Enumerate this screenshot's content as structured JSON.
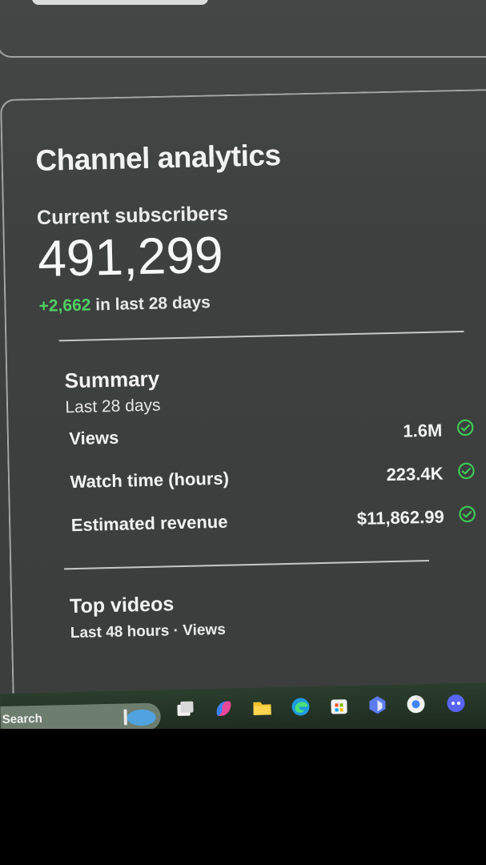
{
  "header": {
    "title": "Channel analytics"
  },
  "subscribers": {
    "label": "Current subscribers",
    "value": "491,299",
    "delta_value": "+2,662",
    "delta_suffix": " in last 28 days"
  },
  "summary": {
    "title": "Summary",
    "period": "Last 28 days",
    "metrics": [
      {
        "label": "Views",
        "value": "1.6M",
        "status_icon": "check-circle-icon"
      },
      {
        "label": "Watch time (hours)",
        "value": "223.4K",
        "status_icon": "check-circle-icon"
      },
      {
        "label": "Estimated revenue",
        "value": "$11,862.99",
        "status_icon": "check-circle-icon"
      }
    ]
  },
  "top_videos": {
    "title": "Top videos",
    "subtitle": "Last 48 hours · Views"
  },
  "taskbar": {
    "search_label": "Search",
    "icons": [
      "task-view-icon",
      "copilot-icon",
      "file-explorer-icon",
      "edge-icon",
      "store-icon",
      "app-icon",
      "chrome-icon",
      "discord-icon"
    ]
  },
  "colors": {
    "positive": "#4fd063",
    "check": "#3fca55",
    "card_bg": "#3d403f"
  }
}
